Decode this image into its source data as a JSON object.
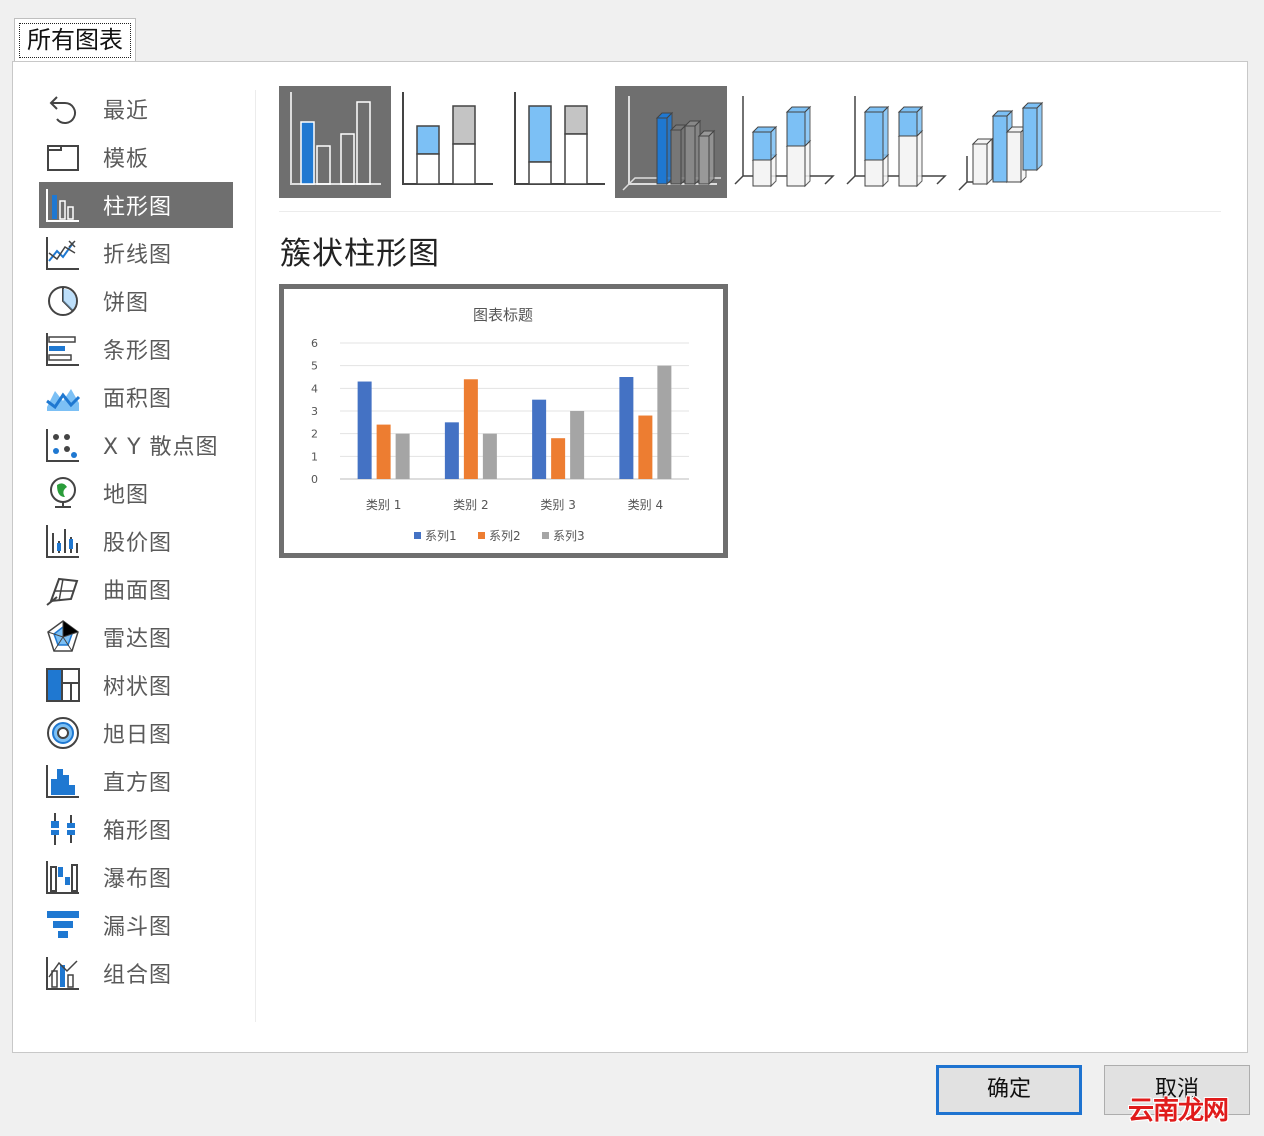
{
  "dialog": {
    "tab_label": "所有图表",
    "selected_chart_type_title": "簇状柱形图",
    "ok_label": "确定",
    "cancel_label": "取消",
    "watermark": "云南龙网"
  },
  "sidebar": {
    "items": [
      {
        "label": "最近",
        "icon": "recent-icon"
      },
      {
        "label": "模板",
        "icon": "template-folder-icon"
      },
      {
        "label": "柱形图",
        "icon": "column-chart-icon",
        "selected": true
      },
      {
        "label": "折线图",
        "icon": "line-chart-icon"
      },
      {
        "label": "饼图",
        "icon": "pie-chart-icon"
      },
      {
        "label": "条形图",
        "icon": "bar-chart-icon"
      },
      {
        "label": "面积图",
        "icon": "area-chart-icon"
      },
      {
        "label": "X Y 散点图",
        "icon": "scatter-chart-icon"
      },
      {
        "label": "地图",
        "icon": "map-globe-icon"
      },
      {
        "label": "股价图",
        "icon": "stock-chart-icon"
      },
      {
        "label": "曲面图",
        "icon": "surface-chart-icon"
      },
      {
        "label": "雷达图",
        "icon": "radar-chart-icon"
      },
      {
        "label": "树状图",
        "icon": "treemap-icon"
      },
      {
        "label": "旭日图",
        "icon": "sunburst-icon"
      },
      {
        "label": "直方图",
        "icon": "histogram-icon"
      },
      {
        "label": "箱形图",
        "icon": "box-whisker-icon"
      },
      {
        "label": "瀑布图",
        "icon": "waterfall-icon"
      },
      {
        "label": "漏斗图",
        "icon": "funnel-icon"
      },
      {
        "label": "组合图",
        "icon": "combo-chart-icon"
      }
    ]
  },
  "subtypes": [
    {
      "icon": "clustered-column-icon",
      "selected": true
    },
    {
      "icon": "stacked-column-icon"
    },
    {
      "icon": "percent-stacked-column-icon"
    },
    {
      "icon": "3d-clustered-column-icon",
      "highlighted": true
    },
    {
      "icon": "3d-stacked-column-icon"
    },
    {
      "icon": "3d-percent-stacked-column-icon"
    },
    {
      "icon": "3d-column-icon"
    }
  ],
  "colors": {
    "selected_bg": "#6f6f6f",
    "icon_blue": "#1f78d1",
    "icon_light_blue": "#7cc0f5",
    "series1": "#4472c4",
    "series2": "#ed7d31",
    "series3": "#a5a5a5",
    "ok_border": "#1e73d0"
  },
  "chart_data": {
    "type": "bar",
    "title": "图表标题",
    "categories": [
      "类别 1",
      "类别 2",
      "类别 3",
      "类别 4"
    ],
    "series": [
      {
        "name": "系列1",
        "values": [
          4.3,
          2.5,
          3.5,
          4.5
        ],
        "color": "#4472c4"
      },
      {
        "name": "系列2",
        "values": [
          2.4,
          4.4,
          1.8,
          2.8
        ],
        "color": "#ed7d31"
      },
      {
        "name": "系列3",
        "values": [
          2,
          2,
          3,
          5
        ],
        "color": "#a5a5a5"
      }
    ],
    "yticks": [
      "0",
      "1",
      "2",
      "3",
      "4",
      "5",
      "6"
    ],
    "ylim": [
      0,
      6
    ],
    "grid": true,
    "legend": "bottom"
  }
}
